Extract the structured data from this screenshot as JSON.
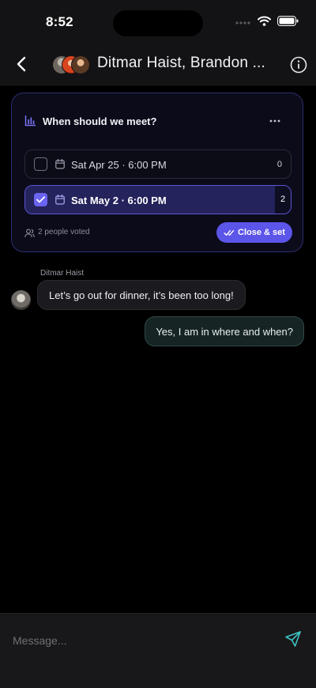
{
  "status_bar": {
    "time": "8:52"
  },
  "header": {
    "title": "Ditmar Haist, Brandon ..."
  },
  "poll": {
    "question": "When should we meet?",
    "options": [
      {
        "label": "Sat Apr 25 · 6:00 PM",
        "count": "0",
        "selected": false
      },
      {
        "label": "Sat May 2 · 6:00 PM",
        "count": "2",
        "selected": true
      }
    ],
    "vote_share_selected": 0.94,
    "voted_text": "2 people voted",
    "close_button_label": "Close & set"
  },
  "messages": [
    {
      "sender": "Ditmar Haist",
      "text": "Let’s go out for dinner, it’s been too long!",
      "direction": "incoming"
    },
    {
      "sender": "",
      "text": "Yes, I am in where and when?",
      "direction": "outgoing"
    }
  ],
  "composer": {
    "placeholder": "Message..."
  },
  "colors": {
    "accent": "#5c55e9",
    "outgoing_bubble": "#172424",
    "send_icon": "#3ec3c2"
  }
}
